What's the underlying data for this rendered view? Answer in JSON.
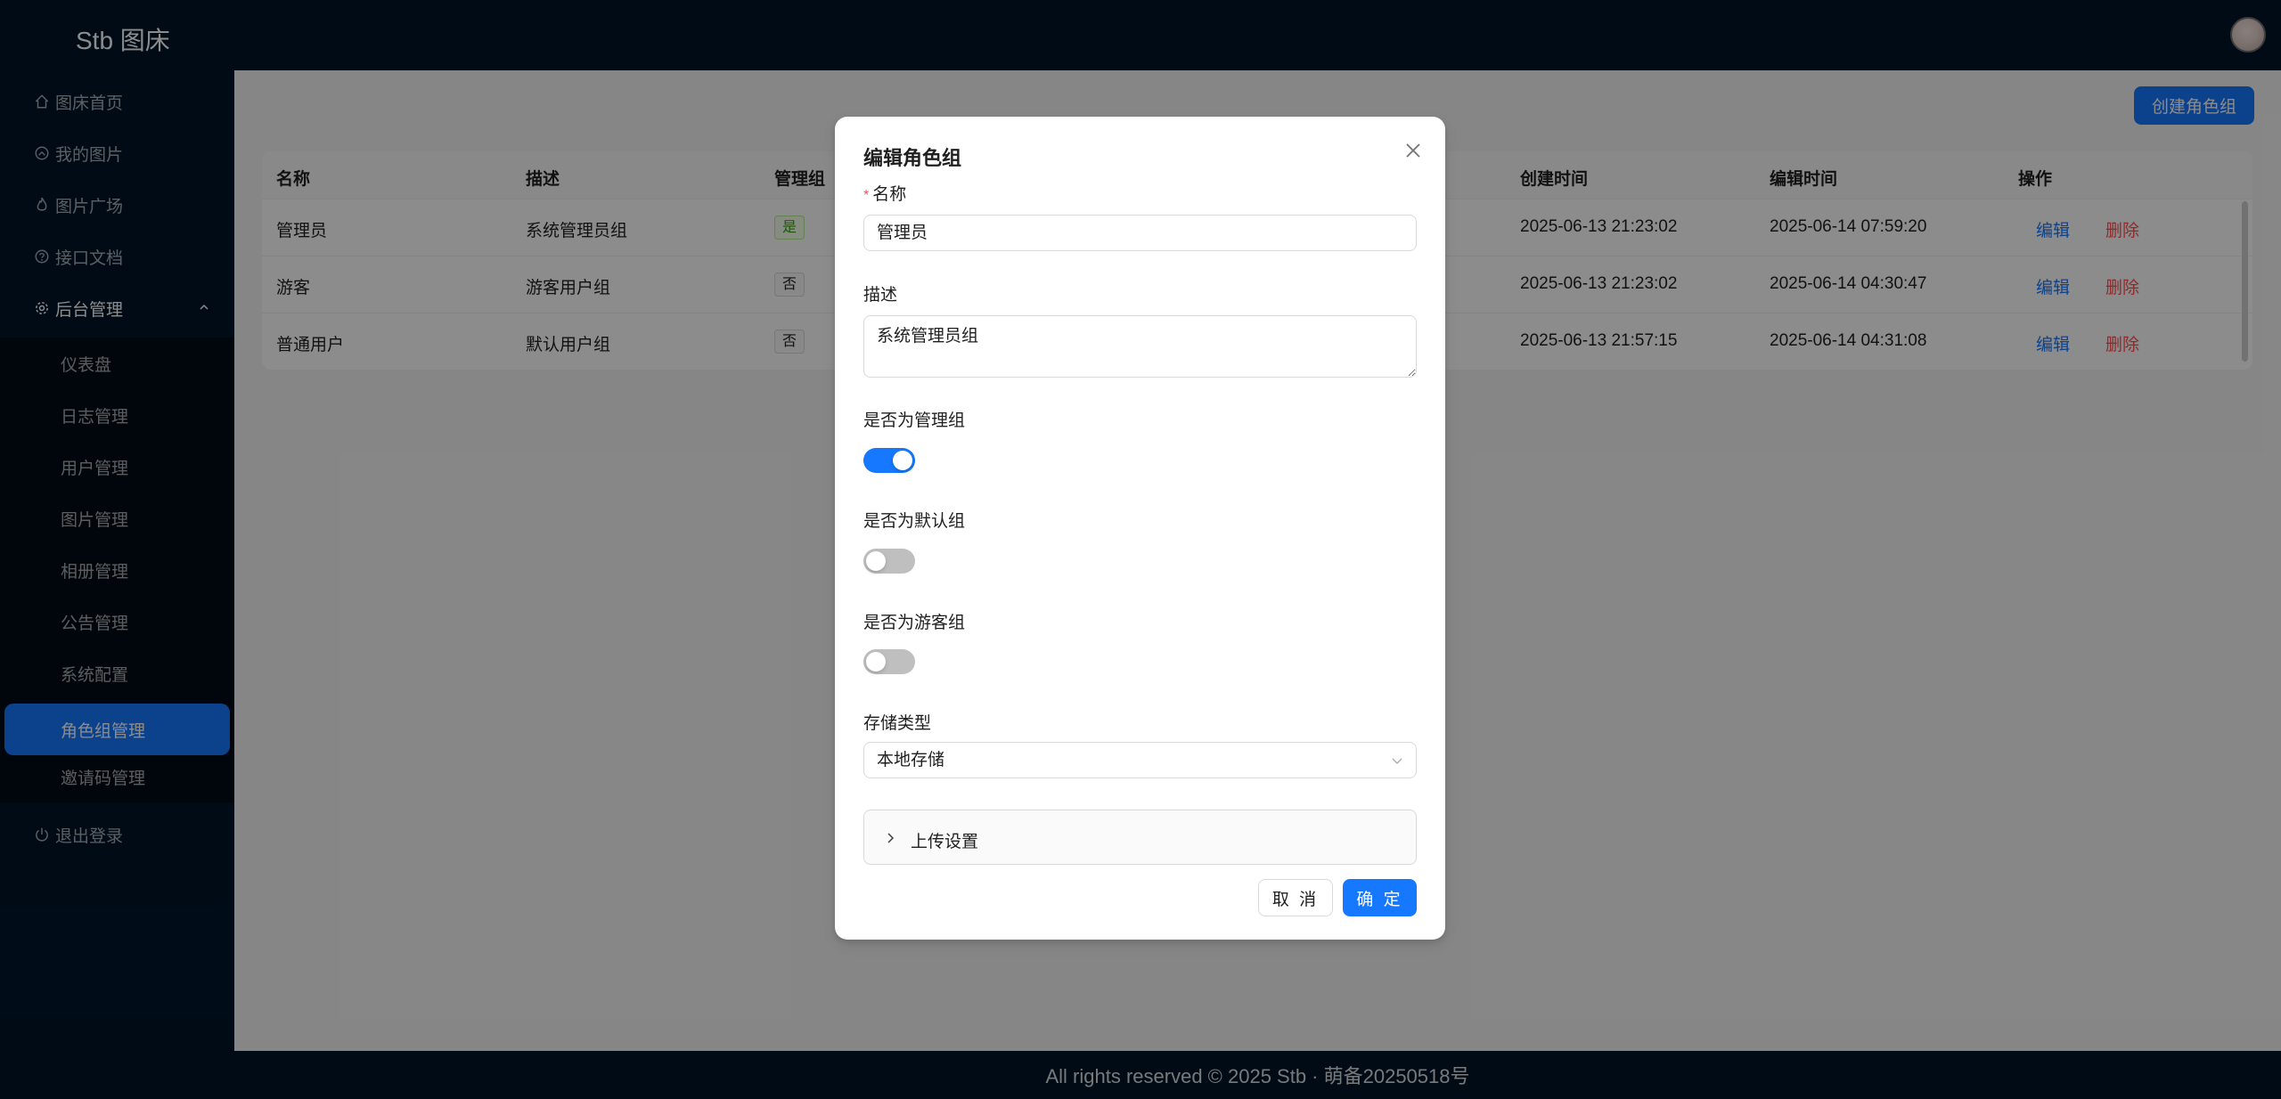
{
  "app": {
    "logo": "Stb 图床"
  },
  "sidebar": {
    "items": [
      {
        "label": "图床首页",
        "icon": "home-icon"
      },
      {
        "label": "我的图片",
        "icon": "image-icon"
      },
      {
        "label": "图片广场",
        "icon": "fire-icon"
      },
      {
        "label": "接口文档",
        "icon": "question-icon"
      },
      {
        "label": "后台管理",
        "icon": "gear-icon"
      }
    ],
    "admin_sub": [
      {
        "label": "仪表盘"
      },
      {
        "label": "日志管理"
      },
      {
        "label": "用户管理"
      },
      {
        "label": "图片管理"
      },
      {
        "label": "相册管理"
      },
      {
        "label": "公告管理"
      },
      {
        "label": "系统配置"
      },
      {
        "label": "角色组管理",
        "active": true
      },
      {
        "label": "邀请码管理"
      }
    ],
    "logout": {
      "label": "退出登录",
      "icon": "power-icon"
    }
  },
  "page": {
    "create_button": "创建角色组",
    "table": {
      "headers": [
        "名称",
        "描述",
        "管理组",
        "创建时间",
        "编辑时间",
        "操作"
      ],
      "rows": [
        {
          "name": "管理员",
          "desc": "系统管理员组",
          "admin": "是",
          "created": "2025-06-13 21:23:02",
          "edited": "2025-06-14 07:59:20",
          "edit": "编辑",
          "delete": "删除"
        },
        {
          "name": "游客",
          "desc": "游客用户组",
          "admin": "否",
          "created": "2025-06-13 21:23:02",
          "edited": "2025-06-14 04:30:47",
          "edit": "编辑",
          "delete": "删除"
        },
        {
          "name": "普通用户",
          "desc": "默认用户组",
          "admin": "否",
          "created": "2025-06-13 21:57:15",
          "edited": "2025-06-14 04:31:08",
          "edit": "编辑",
          "delete": "删除"
        }
      ]
    }
  },
  "footer": {
    "text": "All rights reserved © 2025 Stb · 萌备20250518号"
  },
  "modal": {
    "title": "编辑角色组",
    "required_mark": "*",
    "name_label": "名称",
    "name_value": "管理员",
    "desc_label": "描述",
    "desc_value": "系统管理员组",
    "is_admin_label": "是否为管理组",
    "is_admin": true,
    "is_default_label": "是否为默认组",
    "is_default": false,
    "is_guest_label": "是否为游客组",
    "is_guest": false,
    "storage_label": "存储类型",
    "storage_value": "本地存储",
    "upload_settings": "上传设置",
    "cancel": "取 消",
    "ok": "确 定"
  },
  "colors": {
    "primary": "#1677ff",
    "sidebar_bg": "#001529",
    "danger": "#ff4d4f"
  }
}
